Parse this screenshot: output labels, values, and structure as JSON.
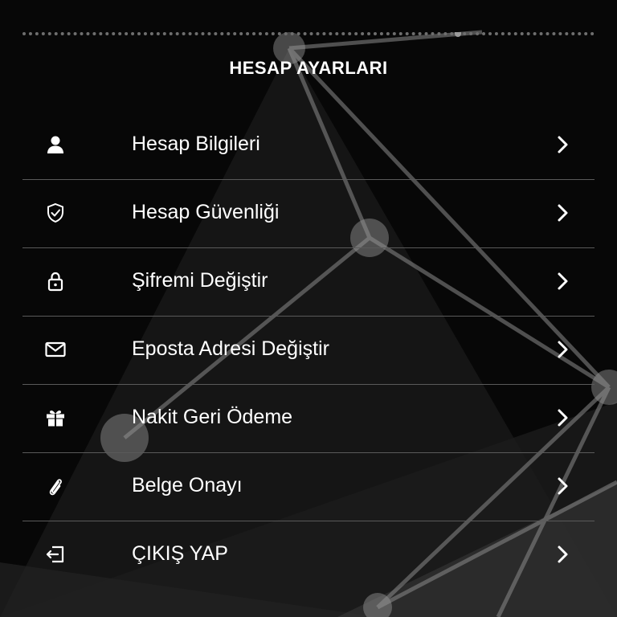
{
  "colors": {
    "background": "#070707",
    "text": "#ffffff",
    "divider": "#5a5a5a"
  },
  "header": {
    "title": "HESAP AYARLARI"
  },
  "menu": {
    "items": [
      {
        "label": "Hesap Bilgileri",
        "icon": "user-icon"
      },
      {
        "label": "Hesap Güvenliği",
        "icon": "shield-check-icon"
      },
      {
        "label": "Şifremi Değiştir",
        "icon": "lock-icon"
      },
      {
        "label": "Eposta Adresi Değiştir",
        "icon": "envelope-icon"
      },
      {
        "label": "Nakit Geri Ödeme",
        "icon": "gift-icon"
      },
      {
        "label": "Belge Onayı",
        "icon": "paperclip-icon"
      },
      {
        "label": "ÇIKIŞ YAP",
        "icon": "logout-icon"
      }
    ],
    "chevron_icon": "chevron-right-icon"
  }
}
